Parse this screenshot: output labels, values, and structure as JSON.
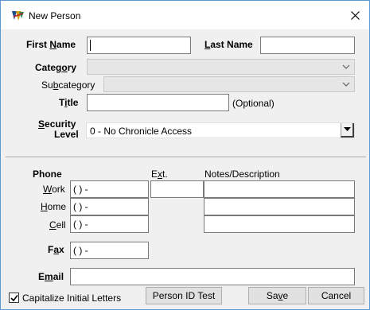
{
  "window": {
    "title": "New Person",
    "icon": "app-logo-icon",
    "close_icon": "close-icon"
  },
  "person": {
    "first_name_label": [
      "First ",
      "N",
      "ame"
    ],
    "first_name_value": "",
    "last_name_label": [
      "L",
      "ast Name"
    ],
    "last_name_value": "",
    "category_label": [
      "Categ",
      "o",
      "ry"
    ],
    "category_value": "",
    "subcategory_label": [
      "Su",
      "b",
      "category"
    ],
    "subcategory_value": "",
    "title_label": [
      "T",
      "i",
      "tle"
    ],
    "title_value": "",
    "title_hint": "(Optional)",
    "security_label_line1": [
      "S",
      "e",
      "curity"
    ],
    "security_label_line2": "Level",
    "security_value": "0 - No Chronicle Access"
  },
  "contact": {
    "phone_header": "Phone",
    "ext_header": [
      "E",
      "x",
      "t."
    ],
    "notes_header": "Notes/Description",
    "work_label": [
      "W",
      "ork"
    ],
    "work_value": "(   )    -",
    "work_ext": "",
    "work_notes": "",
    "home_label": [
      "H",
      "ome"
    ],
    "home_value": "(   )    -",
    "home_notes": "",
    "cell_label": [
      "C",
      "ell"
    ],
    "cell_value": "(   )    -",
    "cell_notes": "",
    "fax_label": [
      "F",
      "a",
      "x"
    ],
    "fax_value": "(   )    -",
    "email_label": [
      "E",
      "m",
      "ail"
    ],
    "email_value": ""
  },
  "footer": {
    "capitalize_label": [
      "Capitalize ",
      "I",
      "nitial Letters"
    ],
    "capitalize_checked": true,
    "person_id_button": "Person ID Test",
    "save_button": [
      "Sa",
      "v",
      "e"
    ],
    "cancel_button": "Cancel"
  },
  "colors": {
    "window_border": "#5b9bd5",
    "dialog_bg": "#f0f0f0",
    "disabled_combo": "#e6e6e6"
  }
}
